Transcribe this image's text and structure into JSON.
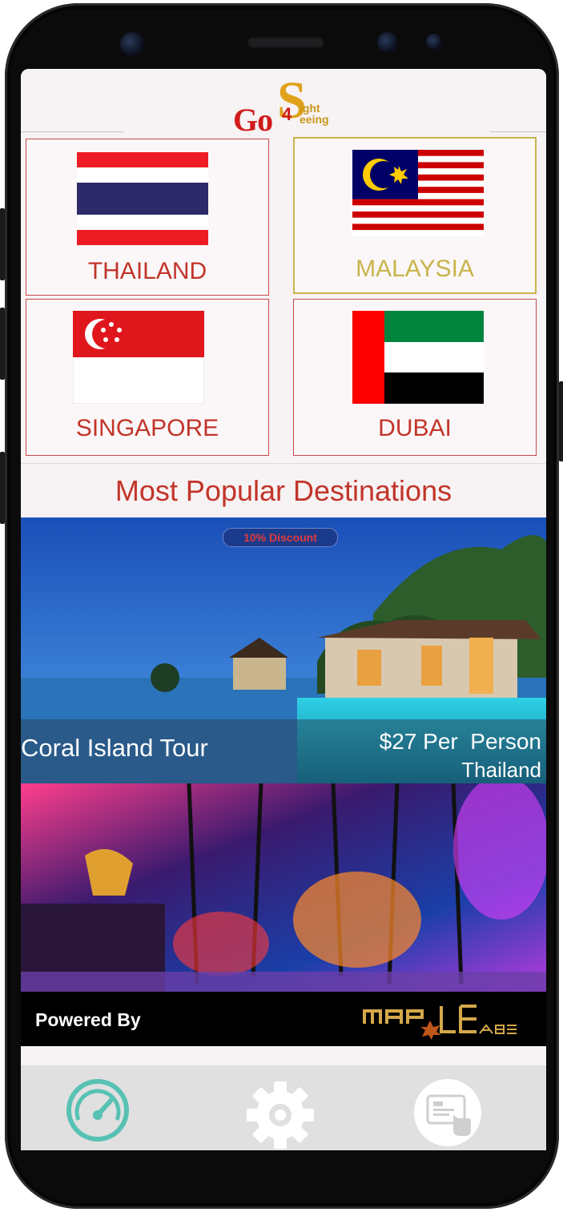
{
  "app": {
    "logo": {
      "go": "Go",
      "four": "4",
      "s": "S",
      "line1": "ight",
      "line2": "eeing"
    }
  },
  "countries": [
    {
      "name": "THAILAND",
      "selected": false,
      "color": "#c2342a",
      "flag": "thailand-flag"
    },
    {
      "name": "MALAYSIA",
      "selected": true,
      "color": "#c8b44a",
      "flag": "malaysia-flag"
    },
    {
      "name": "SINGAPORE",
      "selected": false,
      "color": "#c2342a",
      "flag": "singapore-flag"
    },
    {
      "name": "DUBAI",
      "selected": false,
      "color": "#c2342a",
      "flag": "uae-flag"
    }
  ],
  "popular": {
    "title": "Most Popular Destinations",
    "cards": [
      {
        "badge": "10% Discount",
        "title": "Coral Island Tour",
        "price": "$27 Per  Person",
        "country": "Thailand"
      }
    ]
  },
  "footer": {
    "powered_by": "Powered By",
    "brand": "MAPLE LABS"
  },
  "bottom_nav": {
    "items": [
      {
        "icon": "dashboard-gauge-icon",
        "active": true
      },
      {
        "icon": "gear-icon",
        "active": false
      },
      {
        "icon": "booking-touch-icon",
        "active": false
      }
    ]
  },
  "colors": {
    "accent": "#c2342a",
    "selected": "#c8b44a",
    "nav_active": "#57c2b4"
  }
}
